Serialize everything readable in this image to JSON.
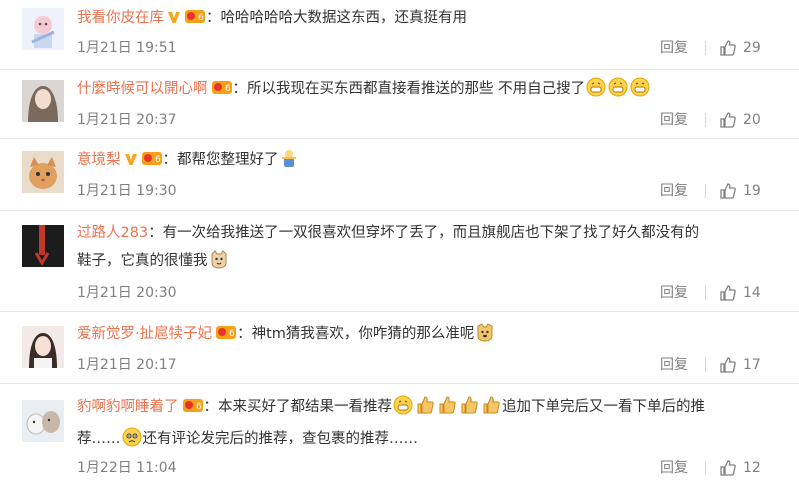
{
  "comments": [
    {
      "username": "我看你皮在库",
      "has_v": true,
      "text_parts": [
        "：哈哈哈哈哈大数据这东西，还真挺有用"
      ],
      "time": "1月21日 19:51",
      "reply_label": "回复",
      "likes": "29",
      "avatar_icon": "pink-character-avatar"
    },
    {
      "username": "什麼時候可以開心啊",
      "has_v": false,
      "text_parts": [
        "：所以我现在买东西都直接看推送的那些 不用自己搜了"
      ],
      "emoji_count_tail": 3,
      "time": "1月21日 20:37",
      "reply_label": "回复",
      "likes": "20",
      "avatar_icon": "girl-portrait-avatar"
    },
    {
      "username": "意境梨",
      "has_v": true,
      "text_parts": [
        "：都帮您整理好了"
      ],
      "time": "1月21日 19:30",
      "reply_label": "回复",
      "likes": "19",
      "avatar_icon": "cat-avatar"
    },
    {
      "username": "过路人283",
      "has_v": false,
      "text_line1": "：有一次给我推送了一双很喜欢但穿坏了丢了，而且旗舰店也下架了找了好久都没有的",
      "text_line2": "鞋子，它真的很懂我",
      "time": "1月21日 20:30",
      "reply_label": "回复",
      "likes": "14",
      "avatar_icon": "dark-red-avatar"
    },
    {
      "username": "爱新觉罗·扯扈犊子妃",
      "has_v": false,
      "text_parts": [
        "：神tm猜我喜欢，你咋猜的那么准呢"
      ],
      "time": "1月21日 20:17",
      "reply_label": "回复",
      "likes": "17",
      "avatar_icon": "girl-photo-avatar"
    },
    {
      "username": "豹啊豹啊睡着了",
      "has_v": false,
      "text_line1_a": "：本来买好了都结果一看推荐",
      "text_line1_b": "追加下单完后又一看下单后的推",
      "text_line2_a": "荐……",
      "text_line2_b": "还有评论发完后的推荐，查包裹的推荐……",
      "time": "1月22日 11:04",
      "reply_label": "回复",
      "likes": "12",
      "avatar_icon": "dog-avatar"
    }
  ],
  "colors": {
    "username": "#eb7350",
    "text": "#333333",
    "meta": "#808080",
    "divider": "#e6e6e6",
    "v_badge": "#f5a623"
  }
}
